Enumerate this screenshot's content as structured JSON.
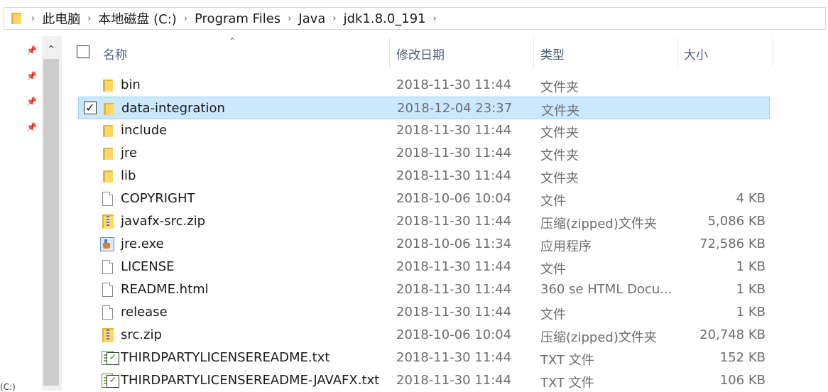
{
  "breadcrumb": [
    "此电脑",
    "本地磁盘 (C:)",
    "Program Files",
    "Java",
    "jdk1.8.0_191"
  ],
  "columns": {
    "name": "名称",
    "date": "修改日期",
    "type": "类型",
    "size": "大小"
  },
  "nav_bottom_label": "(C:)",
  "files": [
    {
      "name": "bin",
      "date": "2018-11-30 11:44",
      "type": "文件夹",
      "size": "",
      "icon": "folder-icon",
      "selected": false
    },
    {
      "name": "data-integration",
      "date": "2018-12-04 23:37",
      "type": "文件夹",
      "size": "",
      "icon": "folder-icon",
      "selected": true
    },
    {
      "name": "include",
      "date": "2018-11-30 11:44",
      "type": "文件夹",
      "size": "",
      "icon": "folder-icon",
      "selected": false
    },
    {
      "name": "jre",
      "date": "2018-11-30 11:44",
      "type": "文件夹",
      "size": "",
      "icon": "folder-icon",
      "selected": false
    },
    {
      "name": "lib",
      "date": "2018-11-30 11:44",
      "type": "文件夹",
      "size": "",
      "icon": "folder-icon",
      "selected": false
    },
    {
      "name": "COPYRIGHT",
      "date": "2018-10-06 10:04",
      "type": "文件",
      "size": "4 KB",
      "icon": "file-icon",
      "selected": false
    },
    {
      "name": "javafx-src.zip",
      "date": "2018-11-30 11:44",
      "type": "压缩(zipped)文件夹",
      "size": "5,086 KB",
      "icon": "zip-icon",
      "selected": false
    },
    {
      "name": "jre.exe",
      "date": "2018-10-06 11:34",
      "type": "应用程序",
      "size": "72,586 KB",
      "icon": "java-exe-icon",
      "selected": false
    },
    {
      "name": "LICENSE",
      "date": "2018-11-30 11:44",
      "type": "文件",
      "size": "1 KB",
      "icon": "file-icon",
      "selected": false
    },
    {
      "name": "README.html",
      "date": "2018-11-30 11:44",
      "type": "360 se HTML Docu...",
      "size": "1 KB",
      "icon": "file-icon",
      "selected": false
    },
    {
      "name": "release",
      "date": "2018-11-30 11:44",
      "type": "文件",
      "size": "1 KB",
      "icon": "file-icon",
      "selected": false
    },
    {
      "name": "src.zip",
      "date": "2018-10-06 10:04",
      "type": "压缩(zipped)文件夹",
      "size": "20,748 KB",
      "icon": "zip-icon",
      "selected": false
    },
    {
      "name": "THIRDPARTYLICENSEREADME.txt",
      "date": "2018-11-30 11:44",
      "type": "TXT 文件",
      "size": "152 KB",
      "icon": "txt-icon",
      "selected": false
    },
    {
      "name": "THIRDPARTYLICENSEREADME-JAVAFX.txt",
      "date": "2018-11-30 11:44",
      "type": "TXT 文件",
      "size": "106 KB",
      "icon": "txt-icon",
      "selected": false
    }
  ]
}
